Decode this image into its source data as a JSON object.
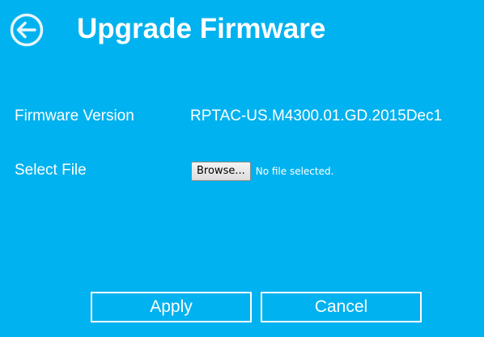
{
  "header": {
    "title": "Upgrade Firmware",
    "back_icon": "arrow-left-circle-icon"
  },
  "firmware": {
    "label": "Firmware Version",
    "value": "RPTAC-US.M4300.01.GD.2015Dec1"
  },
  "file": {
    "label": "Select File",
    "browse_label": "Browse...",
    "status": "No file selected."
  },
  "actions": {
    "apply_label": "Apply",
    "cancel_label": "Cancel"
  },
  "colors": {
    "background": "#00b2ef",
    "text": "#ffffff",
    "button_border": "#ffffff"
  }
}
